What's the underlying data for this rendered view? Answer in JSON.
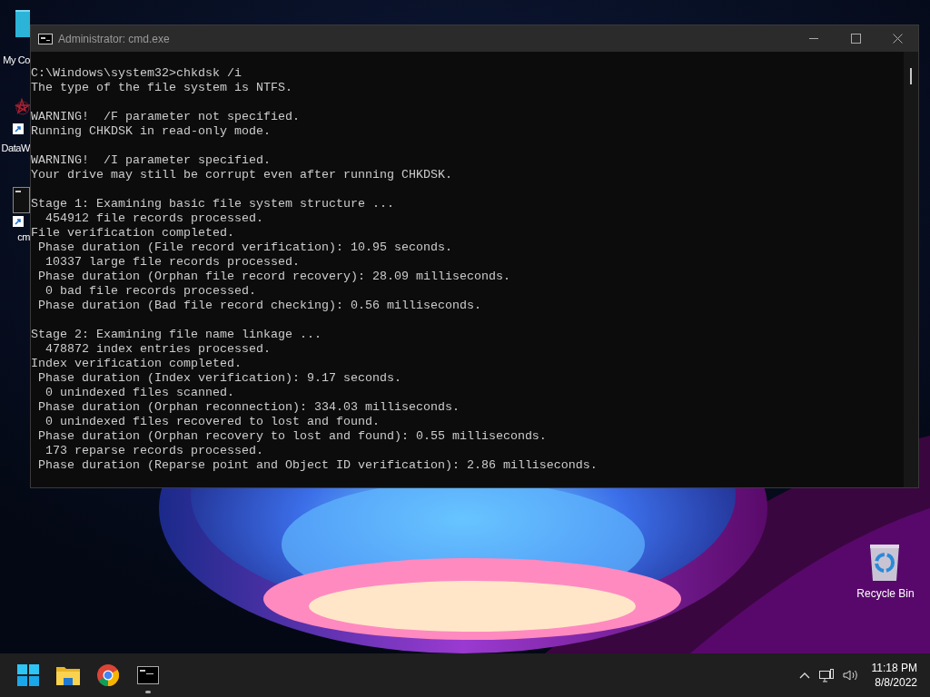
{
  "desktop_icons": [
    {
      "label": "My Co",
      "kind": "monitor"
    },
    {
      "label": "DataW",
      "kind": "app"
    },
    {
      "label": "cm",
      "kind": "console"
    },
    {
      "label": "Recycle Bin",
      "kind": "bin"
    }
  ],
  "window": {
    "title": "Administrator: cmd.exe",
    "console_blocks": [
      [
        "C:\\Windows\\system32>chkdsk /i",
        "The type of the file system is NTFS."
      ],
      [
        "WARNING!  /F parameter not specified.",
        "Running CHKDSK in read-only mode."
      ],
      [
        "WARNING!  /I parameter specified.",
        "Your drive may still be corrupt even after running CHKDSK."
      ],
      [
        "Stage 1: Examining basic file system structure ...",
        "  454912 file records processed.",
        "File verification completed.",
        " Phase duration (File record verification): 10.95 seconds.",
        "  10337 large file records processed.",
        " Phase duration (Orphan file record recovery): 28.09 milliseconds.",
        "  0 bad file records processed.",
        " Phase duration (Bad file record checking): 0.56 milliseconds."
      ],
      [
        "Stage 2: Examining file name linkage ...",
        "  478872 index entries processed.",
        "Index verification completed.",
        " Phase duration (Index verification): 9.17 seconds.",
        "  0 unindexed files scanned.",
        " Phase duration (Orphan reconnection): 334.03 milliseconds.",
        "  0 unindexed files recovered to lost and found.",
        " Phase duration (Orphan recovery to lost and found): 0.55 milliseconds.",
        "  173 reparse records processed.",
        " Phase duration (Reparse point and Object ID verification): 2.86 milliseconds."
      ]
    ]
  },
  "taskbar": {
    "apps": [
      {
        "kind": "start",
        "running": false
      },
      {
        "kind": "folder",
        "running": false
      },
      {
        "kind": "browser",
        "running": false
      },
      {
        "kind": "console",
        "running": true
      }
    ],
    "time": "11:18 PM",
    "date": "8/8/2022"
  }
}
